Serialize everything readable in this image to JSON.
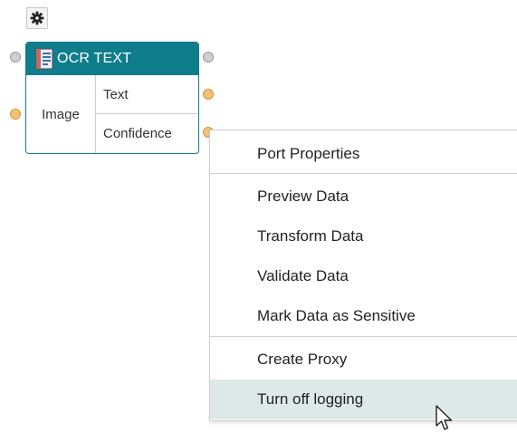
{
  "node": {
    "title": "OCR TEXT",
    "icon": "document-icon",
    "header_color": "#0f7d8c",
    "inputs": [
      {
        "label": "Image"
      }
    ],
    "outputs": [
      {
        "label": "Text"
      },
      {
        "label": "Confidence"
      }
    ]
  },
  "toolbar": {
    "settings_icon": "gear-icon"
  },
  "context_menu": {
    "groups": [
      [
        {
          "label": "Port Properties"
        }
      ],
      [
        {
          "label": "Preview Data"
        },
        {
          "label": "Transform Data"
        },
        {
          "label": "Validate Data"
        },
        {
          "label": "Mark Data as Sensitive"
        }
      ],
      [
        {
          "label": "Create Proxy"
        },
        {
          "label": "Turn off logging",
          "highlighted": true
        }
      ]
    ],
    "highlight_color": "#dde9e7"
  },
  "port_colors": {
    "control": "#cfcfcf",
    "data": "#f3c27a"
  }
}
